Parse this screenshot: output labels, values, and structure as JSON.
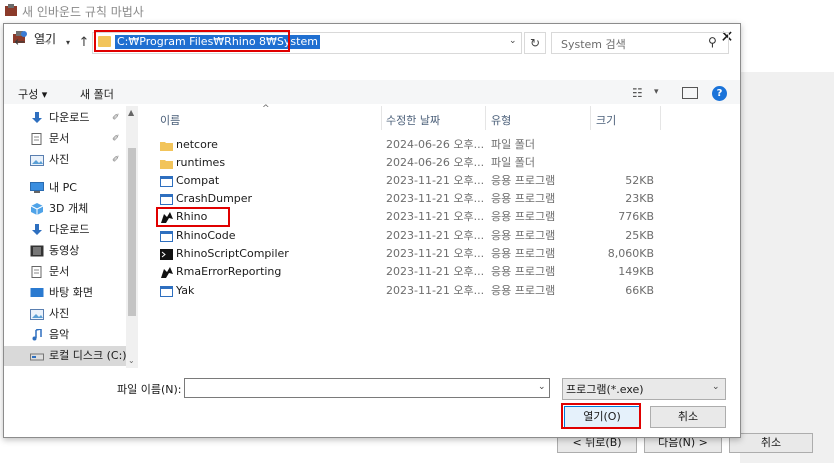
{
  "wizard": {
    "title": "새 인바운드 규칙 마법사",
    "back_label": "< 뒤로(B)",
    "next_label": "다음(N) >",
    "cancel_label": "취소"
  },
  "dialog": {
    "title": "열기",
    "address": "C:₩Program Files₩Rhino 8₩System",
    "search_placeholder": "System 검색",
    "toolbar": {
      "organize": "구성 ▾",
      "new_folder": "새 폴더"
    },
    "nav_items": [
      {
        "label": "다운로드",
        "icon": "download-arrow-icon",
        "pinned": true
      },
      {
        "label": "문서",
        "icon": "document-icon",
        "pinned": true
      },
      {
        "label": "사진",
        "icon": "pictures-icon",
        "pinned": true
      },
      {
        "label": "내 PC",
        "icon": "pc-icon",
        "pinned": false
      },
      {
        "label": "3D 개체",
        "icon": "3d-objects-icon",
        "pinned": false
      },
      {
        "label": "다운로드",
        "icon": "download-arrow-icon",
        "pinned": false
      },
      {
        "label": "동영상",
        "icon": "video-icon",
        "pinned": false
      },
      {
        "label": "문서",
        "icon": "document-icon",
        "pinned": false
      },
      {
        "label": "바탕 화면",
        "icon": "desktop-icon",
        "pinned": false
      },
      {
        "label": "사진",
        "icon": "pictures-icon",
        "pinned": false
      },
      {
        "label": "음악",
        "icon": "music-note-icon",
        "pinned": false
      },
      {
        "label": "로컬 디스크 (C:)",
        "icon": "local-disk-icon",
        "pinned": false
      }
    ],
    "columns": {
      "name": "이름",
      "modified": "수정한 날짜",
      "type": "유형",
      "size": "크기"
    },
    "files": [
      {
        "name": "netcore",
        "modified": "2024-06-26 오후...",
        "type": "파일 폴더",
        "size": "",
        "icon": "folder-icon"
      },
      {
        "name": "runtimes",
        "modified": "2024-06-26 오후...",
        "type": "파일 폴더",
        "size": "",
        "icon": "folder-icon"
      },
      {
        "name": "Compat",
        "modified": "2023-11-21 오후...",
        "type": "응용 프로그램",
        "size": "52KB",
        "icon": "app-window-icon"
      },
      {
        "name": "CrashDumper",
        "modified": "2023-11-21 오후...",
        "type": "응용 프로그램",
        "size": "23KB",
        "icon": "app-window-icon"
      },
      {
        "name": "Rhino",
        "modified": "2023-11-21 오후...",
        "type": "응용 프로그램",
        "size": "776KB",
        "icon": "rhino-logo-icon"
      },
      {
        "name": "RhinoCode",
        "modified": "2023-11-21 오후...",
        "type": "응용 프로그램",
        "size": "25KB",
        "icon": "app-window-icon"
      },
      {
        "name": "RhinoScriptCompiler",
        "modified": "2023-11-21 오후...",
        "type": "응용 프로그램",
        "size": "8,060KB",
        "icon": "console-icon"
      },
      {
        "name": "RmaErrorReporting",
        "modified": "2023-11-21 오후...",
        "type": "응용 프로그램",
        "size": "149KB",
        "icon": "rhino-logo-icon"
      },
      {
        "name": "Yak",
        "modified": "2023-11-21 오후...",
        "type": "응용 프로그램",
        "size": "66KB",
        "icon": "app-window-icon"
      }
    ],
    "filename_label": "파일 이름(N):",
    "filename_value": "",
    "filetype_value": "프로그램(*.exe)",
    "open_label": "열기(O)",
    "cancel_label": "취소"
  },
  "colors": {
    "highlight": "#e00000",
    "selection": "#1f6fd1",
    "folder": "#f2c45a"
  }
}
